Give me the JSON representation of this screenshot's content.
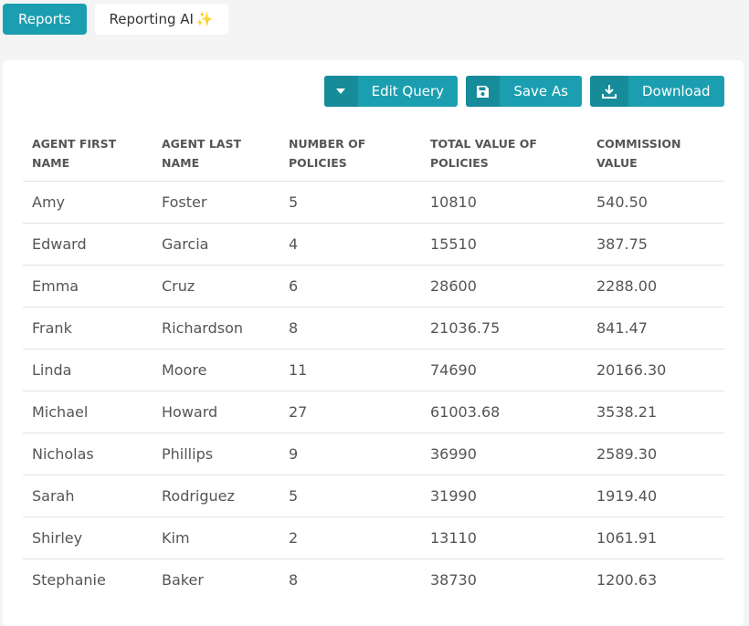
{
  "tabs": [
    {
      "label": "Reports",
      "active": true
    },
    {
      "label": "Reporting AI",
      "active": false,
      "icon": "sparkles-icon"
    }
  ],
  "toolbar": {
    "edit_query_label": "Edit Query",
    "save_as_label": "Save As",
    "download_label": "Download"
  },
  "table": {
    "columns": [
      [
        "AGENT FIRST",
        "NAME"
      ],
      [
        "AGENT LAST",
        "NAME"
      ],
      [
        "NUMBER OF",
        "POLICIES"
      ],
      [
        "TOTAL VALUE OF",
        "POLICIES"
      ],
      [
        "COMMISSION",
        "VALUE"
      ]
    ],
    "rows": [
      [
        "Amy",
        "Foster",
        "5",
        "10810",
        "540.50"
      ],
      [
        "Edward",
        "Garcia",
        "4",
        "15510",
        "387.75"
      ],
      [
        "Emma",
        "Cruz",
        "6",
        "28600",
        "2288.00"
      ],
      [
        "Frank",
        "Richardson",
        "8",
        "21036.75",
        "841.47"
      ],
      [
        "Linda",
        "Moore",
        "11",
        "74690",
        "20166.30"
      ],
      [
        "Michael",
        "Howard",
        "27",
        "61003.68",
        "3538.21"
      ],
      [
        "Nicholas",
        "Phillips",
        "9",
        "36990",
        "2589.30"
      ],
      [
        "Sarah",
        "Rodriguez",
        "5",
        "31990",
        "1919.40"
      ],
      [
        "Shirley",
        "Kim",
        "2",
        "13110",
        "1061.91"
      ],
      [
        "Stephanie",
        "Baker",
        "8",
        "38730",
        "1200.63"
      ]
    ]
  },
  "colors": {
    "accent": "#1b9fb0",
    "accent_dark": "#168c9b",
    "background": "#f4f4f4"
  }
}
